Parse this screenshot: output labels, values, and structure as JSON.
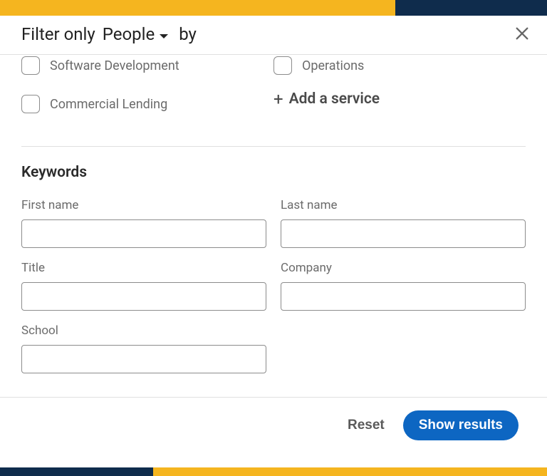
{
  "header": {
    "prefix": "Filter only",
    "entity": "People",
    "suffix": "by"
  },
  "services": {
    "left": [
      {
        "label": "Software Development"
      },
      {
        "label": "Commercial Lending"
      }
    ],
    "right": [
      {
        "label": "Operations"
      }
    ],
    "add_label": "Add a service"
  },
  "keywords": {
    "section_title": "Keywords",
    "fields": {
      "first_name": {
        "label": "First name",
        "value": ""
      },
      "last_name": {
        "label": "Last name",
        "value": ""
      },
      "title": {
        "label": "Title",
        "value": ""
      },
      "company": {
        "label": "Company",
        "value": ""
      },
      "school": {
        "label": "School",
        "value": ""
      }
    }
  },
  "footer": {
    "reset": "Reset",
    "show": "Show results"
  }
}
